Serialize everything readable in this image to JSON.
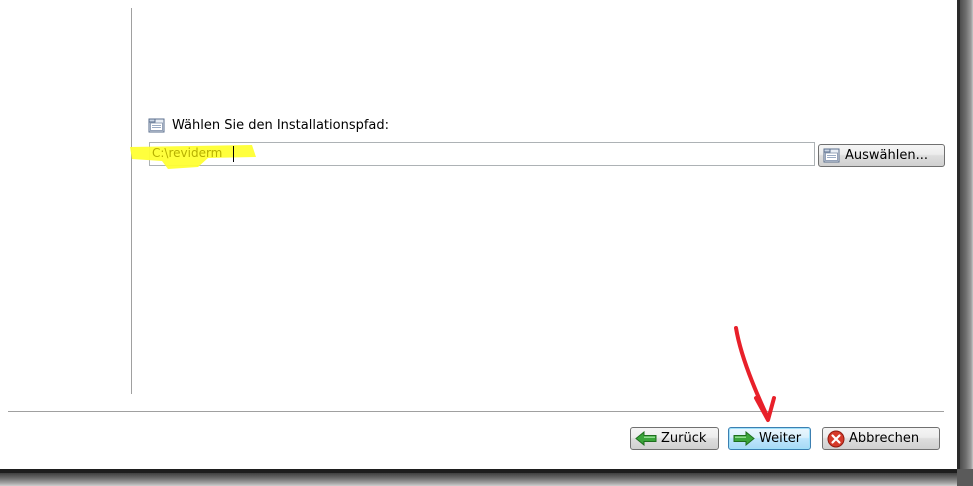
{
  "installer": {
    "path_label": "Wählen Sie den Installationspfad:",
    "path_value": "C:\\reviderm",
    "browse_label": "Auswählen...",
    "back_label": "Zurück",
    "next_label": "Weiter",
    "cancel_label": "Abbrechen"
  },
  "icons": {
    "label_icon": "folder-icon",
    "browse_icon": "folder-icon",
    "back_icon": "green-arrow-left-icon",
    "next_icon": "green-arrow-right-icon",
    "cancel_icon": "red-x-icon"
  },
  "colors": {
    "highlight": "#ffff33",
    "annotation_arrow": "#e8202a",
    "focus_border": "#3c7fb1",
    "arrow_green": "#3aa53a",
    "cancel_red": "#d63a2a"
  }
}
